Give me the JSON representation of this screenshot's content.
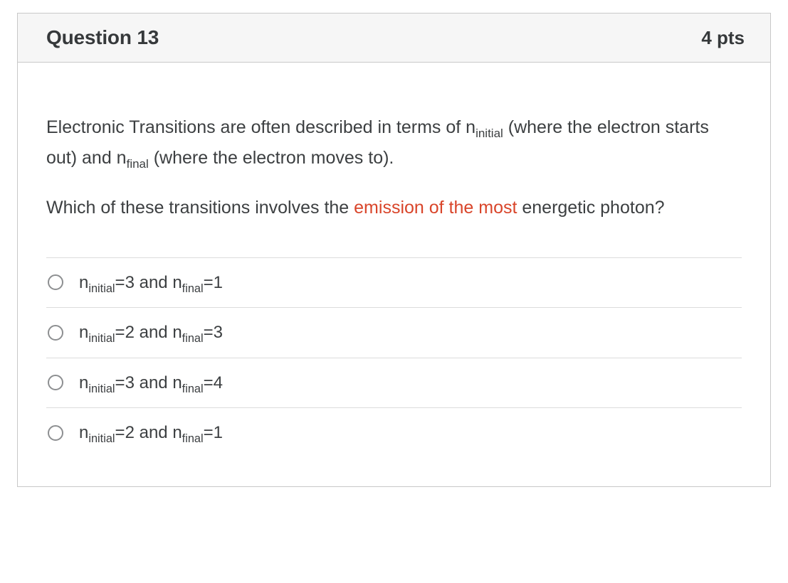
{
  "header": {
    "title": "Question 13",
    "points": "4 pts"
  },
  "prompt": {
    "p1_before": "Electronic Transitions are often described in terms of n",
    "p1_sub1": "initial",
    "p1_mid": " (where the electron starts out) and n",
    "p1_sub2": "final",
    "p1_after": " (where the electron moves to).",
    "p2_before": "Which of these transitions involves the ",
    "p2_emph": "emission of the most",
    "p2_after": " energetic photon?"
  },
  "answers": [
    {
      "n_initial": "3",
      "n_final": "1"
    },
    {
      "n_initial": "2",
      "n_final": "3"
    },
    {
      "n_initial": "3",
      "n_final": "4"
    },
    {
      "n_initial": "2",
      "n_final": "1"
    }
  ],
  "labels": {
    "sub_initial": "initial",
    "sub_final": "final",
    "and": " and "
  }
}
